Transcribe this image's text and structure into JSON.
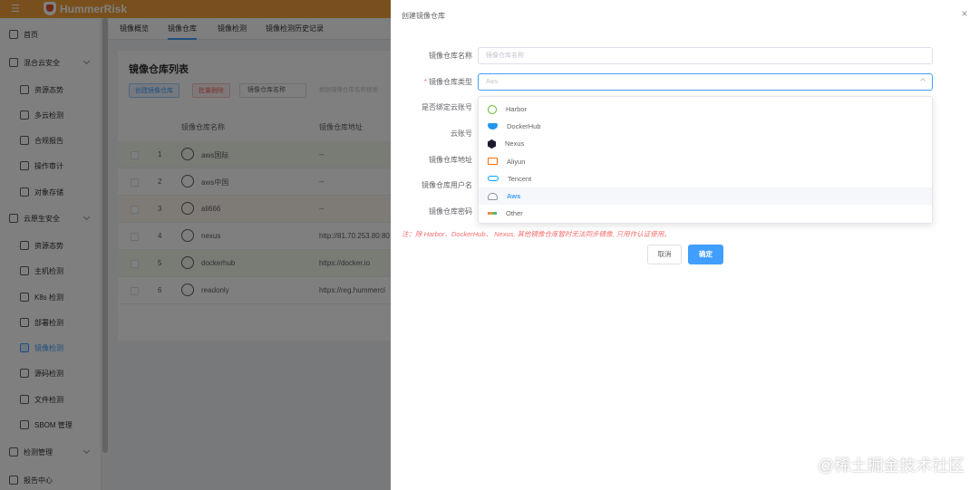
{
  "app": {
    "brand": "HummerRisk"
  },
  "sidebar": {
    "items": [
      {
        "label": "首页",
        "level": 0,
        "icon": "dashboard-icon"
      },
      {
        "label": "混合云安全",
        "level": 0,
        "icon": "cloud-icon",
        "expandable": true
      },
      {
        "label": "资源态势",
        "level": 1,
        "icon": "resource-icon"
      },
      {
        "label": "多云检测",
        "level": 1,
        "icon": "scan-icon"
      },
      {
        "label": "合规报告",
        "level": 1,
        "icon": "report-icon"
      },
      {
        "label": "操作审计",
        "level": 1,
        "icon": "audit-icon"
      },
      {
        "label": "对象存储",
        "level": 1,
        "icon": "storage-icon"
      },
      {
        "label": "云原生安全",
        "level": 0,
        "icon": "cloud-native-icon",
        "expandable": true
      },
      {
        "label": "资源态势",
        "level": 1,
        "icon": "resource-icon"
      },
      {
        "label": "主机检测",
        "level": 1,
        "icon": "server-icon"
      },
      {
        "label": "K8s 检测",
        "level": 1,
        "icon": "k8s-icon"
      },
      {
        "label": "部署检测",
        "level": 1,
        "icon": "deploy-icon"
      },
      {
        "label": "镜像检测",
        "level": 1,
        "icon": "image-icon",
        "active": true
      },
      {
        "label": "源码检测",
        "level": 1,
        "icon": "code-icon"
      },
      {
        "label": "文件检测",
        "level": 1,
        "icon": "file-icon"
      },
      {
        "label": "SBOM 管理",
        "level": 1,
        "icon": "sbom-icon"
      },
      {
        "label": "检测管理",
        "level": 0,
        "icon": "manage-icon",
        "expandable": true
      },
      {
        "label": "报告中心",
        "level": 0,
        "icon": "report-center-icon"
      }
    ]
  },
  "tabs": [
    {
      "label": "镜像概览"
    },
    {
      "label": "镜像仓库",
      "active": true
    },
    {
      "label": "镜像检测"
    },
    {
      "label": "镜像检测历史记录"
    }
  ],
  "list": {
    "title": "镜像仓库列表",
    "create_label": "创建镜像仓库",
    "delete_label": "批量删除",
    "filter_select": "镜像仓库名称",
    "search_placeholder": "根据镜像仓库名称搜索",
    "columns": [
      "镜像仓库名称",
      "镜像仓库地址"
    ],
    "rows": [
      {
        "idx": "1",
        "name": "aws国际",
        "addr": "--",
        "icon": "aws-icon",
        "tint": "green"
      },
      {
        "idx": "2",
        "name": "aws中国",
        "addr": "--",
        "icon": "aws-icon",
        "tint": ""
      },
      {
        "idx": "3",
        "name": "ali666",
        "addr": "--",
        "icon": "aliyun-icon",
        "tint": "orange"
      },
      {
        "idx": "4",
        "name": "nexus",
        "addr": "http://81.70.253.80:80",
        "icon": "nexus-icon",
        "tint": ""
      },
      {
        "idx": "5",
        "name": "dockerhub",
        "addr": "https://docker.io",
        "icon": "dockerhub-icon",
        "tint": "green"
      },
      {
        "idx": "6",
        "name": "readonly",
        "addr": "https://reg.hummercl",
        "icon": "harbor-icon",
        "tint": ""
      }
    ]
  },
  "drawer": {
    "title": "创建镜像仓库",
    "fields": {
      "name_label": "镜像仓库名称",
      "name_placeholder": "镜像仓库名称",
      "type_label": "镜像仓库类型",
      "type_value": "Aws",
      "bind_label": "是否绑定云账号",
      "account_label": "云账号",
      "addr_label": "镜像仓库地址",
      "user_label": "镜像仓库用户名",
      "pwd_label": "镜像仓库密码"
    },
    "type_options": [
      {
        "label": "Harbor",
        "icon": "harbor-icon"
      },
      {
        "label": "DockerHub",
        "icon": "dockerhub-icon"
      },
      {
        "label": "Nexus",
        "icon": "nexus-icon"
      },
      {
        "label": "Aliyun",
        "icon": "aliyun-icon"
      },
      {
        "label": "Tencent",
        "icon": "tencent-icon"
      },
      {
        "label": "Aws",
        "icon": "aws-icon",
        "selected": true
      },
      {
        "label": "Other",
        "icon": "other-icon"
      }
    ],
    "note": "注：除 Harbor、DockerHub、 Nexus, 其他镜像仓库暂时无法同步镜像, 只用作认证使用。",
    "cancel_label": "取消",
    "confirm_label": "确定"
  },
  "watermark": "@稀土掘金技术社区",
  "colors": {
    "topbar": "#f2a13a",
    "primary": "#409eff",
    "danger": "#f56c6c",
    "overlay": "rgba(0,0,0,0.5)"
  }
}
